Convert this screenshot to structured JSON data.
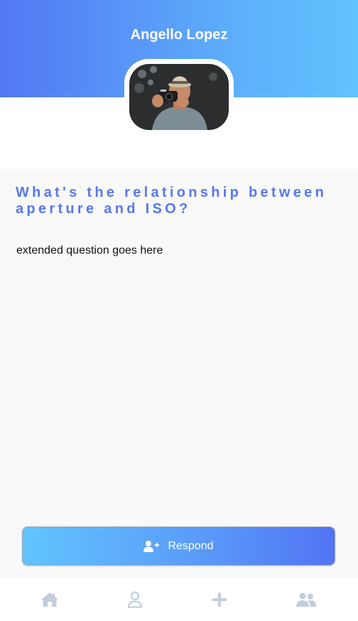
{
  "profile": {
    "name": "Angello Lopez"
  },
  "question": {
    "title": "What's the relationship between aperture and ISO?",
    "body": "extended question goes here"
  },
  "actions": {
    "respond_label": "Respond",
    "respond_icon": "user-plus-icon"
  },
  "nav": {
    "items": [
      {
        "icon": "home-icon"
      },
      {
        "icon": "user-icon"
      },
      {
        "icon": "plus-icon"
      },
      {
        "icon": "users-icon"
      }
    ],
    "icon_color": "#c3cddd"
  },
  "colors": {
    "header_gradient_start": "#5278f4",
    "header_gradient_end": "#62c2ff",
    "title_color": "#5678ee"
  }
}
